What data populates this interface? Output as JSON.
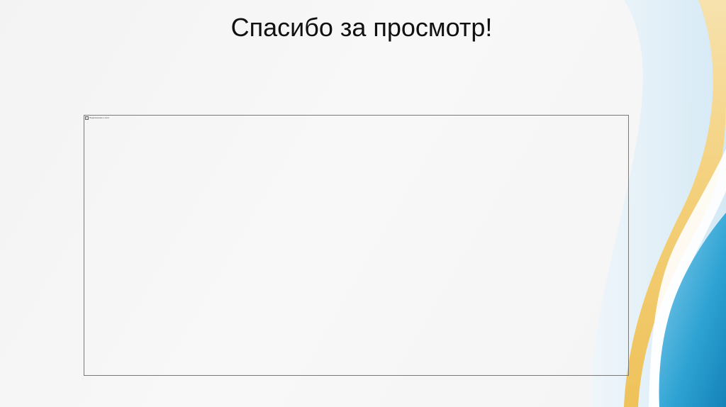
{
  "slide": {
    "title": "Спасибо за просмотр!",
    "image_placeholder": {
      "alt_text": "Подключение к сети"
    }
  },
  "colors": {
    "background": "#f6f6f6",
    "frame_border": "#7a7a7a",
    "accent_gold": "#f2c96a",
    "accent_blue_dark": "#1e8cc0",
    "accent_blue_light": "#8fc9e6",
    "title_text": "#111111"
  },
  "icons": {
    "broken_image": "broken-image-icon"
  }
}
